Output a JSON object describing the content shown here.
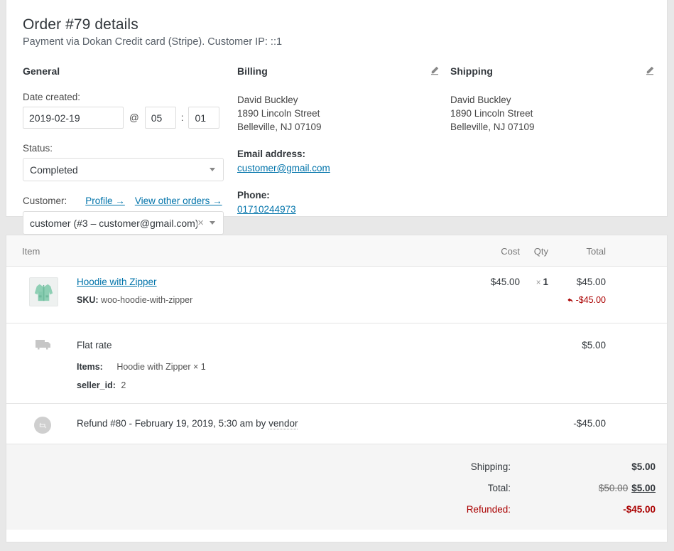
{
  "header": {
    "title": "Order #79 details",
    "subtitle": "Payment via Dokan Credit card (Stripe). Customer IP: ::1"
  },
  "general": {
    "heading": "General",
    "date_label": "Date created:",
    "date_value": "2019-02-19",
    "at_symbol": "@",
    "hour_value": "05",
    "time_separator": ":",
    "minute_value": "01",
    "status_label": "Status:",
    "status_value": "Completed",
    "customer_label": "Customer:",
    "profile_link": "Profile →",
    "other_orders_link": "View other orders →",
    "customer_value": "customer (#3 – customer@gmail.com)"
  },
  "billing": {
    "heading": "Billing",
    "address": "David Buckley\n1890 Lincoln Street\nBelleville, NJ 07109",
    "email_label": "Email address:",
    "email_value": "customer@gmail.com",
    "phone_label": "Phone:",
    "phone_value": "01710244973"
  },
  "shipping_address": {
    "heading": "Shipping",
    "address": "David Buckley\n1890 Lincoln Street\nBelleville, NJ 07109"
  },
  "items": {
    "columns": {
      "item": "Item",
      "cost": "Cost",
      "qty": "Qty",
      "total": "Total"
    },
    "product": {
      "name": "Hoodie with Zipper",
      "sku_label": "SKU:",
      "sku_value": "woo-hoodie-with-zipper",
      "cost": "$45.00",
      "qty_x": "×",
      "qty": "1",
      "total": "$45.00",
      "refunded": "-$45.00"
    },
    "shipping_line": {
      "name": "Flat rate",
      "items_label": "Items:",
      "items_value": "Hoodie with Zipper × 1",
      "seller_label": "seller_id:",
      "seller_value": "2",
      "total": "$5.00"
    },
    "refund_line": {
      "text": "Refund #80 - February 19, 2019, 5:30 am by ",
      "author": "vendor",
      "total": "-$45.00"
    }
  },
  "totals": {
    "shipping_label": "Shipping:",
    "shipping_value": "$5.00",
    "total_label": "Total:",
    "total_old": "$50.00",
    "total_new": "$5.00",
    "refunded_label": "Refunded:",
    "refunded_value": "-$45.00"
  },
  "colors": {
    "link": "#0073aa",
    "refund_red": "#aa0000",
    "page_bg": "#e8e8e8",
    "panel_bg": "#ffffff",
    "totals_bg": "#f5f5f5"
  }
}
